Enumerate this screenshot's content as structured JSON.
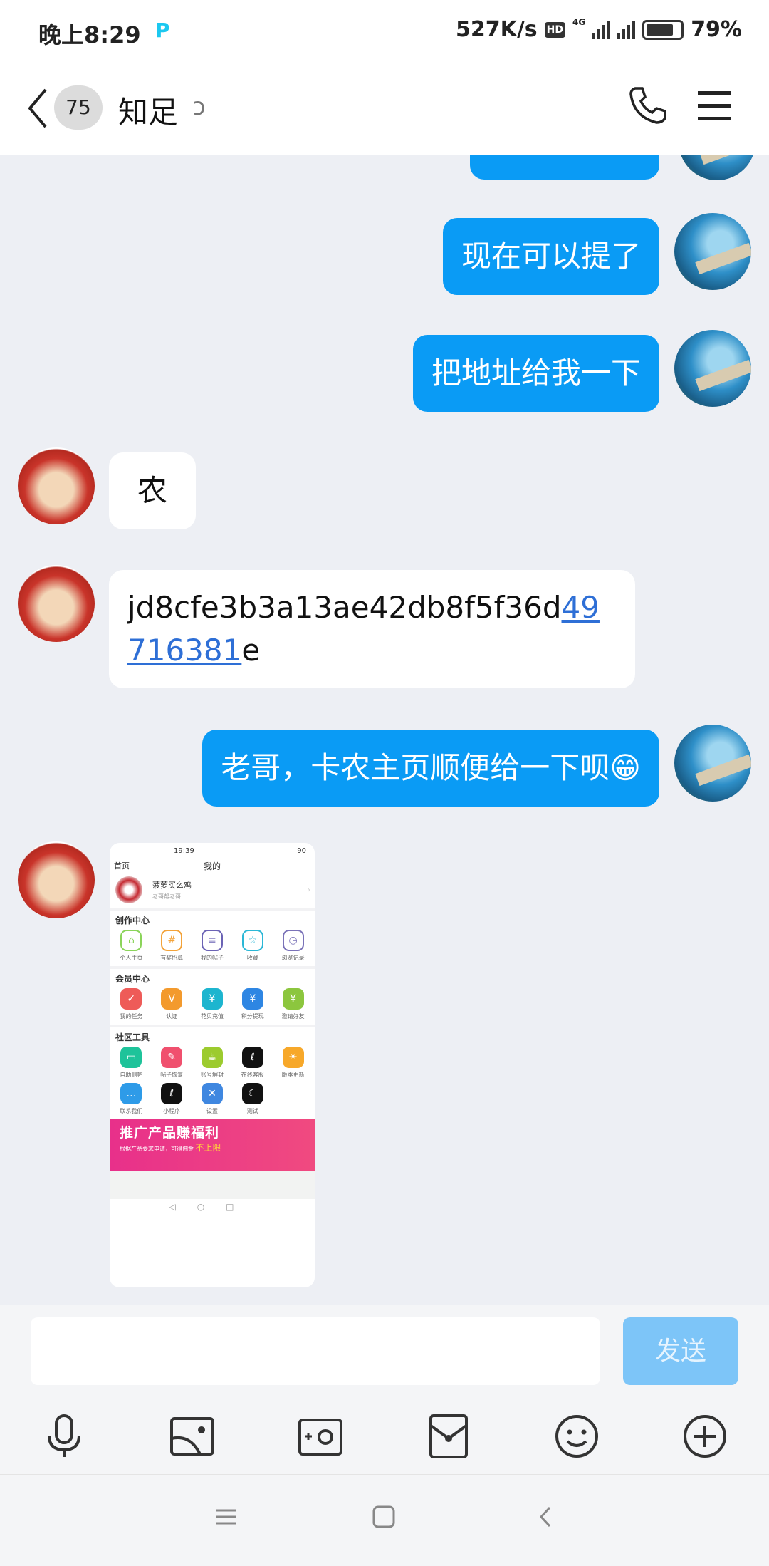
{
  "status_bar": {
    "time": "晚上8:29",
    "app_indicator": "P",
    "net_speed": "527K/s",
    "hd": "HD",
    "network": "4G",
    "battery": "79%",
    "battery_level": 79
  },
  "header": {
    "unread_count": "75",
    "title": "知足",
    "icons": [
      "back-chevron",
      "ear-icon",
      "phone-icon",
      "menu-icon"
    ]
  },
  "messages": [
    {
      "side": "me",
      "text": "现在可以提了"
    },
    {
      "side": "me",
      "text": "把地址给我一下"
    },
    {
      "side": "other",
      "text": "农"
    },
    {
      "side": "other",
      "text_prefix": "jd8cfe3b3a13ae42db8f5f36d",
      "link": "49716381",
      "text_suffix": "e"
    },
    {
      "side": "me",
      "text": "老哥，卡农主页顺便给一下呗😁"
    },
    {
      "side": "other",
      "type": "image"
    }
  ],
  "shared_image": {
    "time": "19:39",
    "battery": "90",
    "back": "首页",
    "title": "我的",
    "username": "菠萝买么鸡",
    "subtitle": "老哥帮老哥",
    "sections": [
      {
        "title": "创作中心",
        "items": [
          "个人主页",
          "有奖招募",
          "我的帖子",
          "收藏",
          "浏览记录"
        ]
      },
      {
        "title": "会员中心",
        "items": [
          "我的任务",
          "认证",
          "花贝充值",
          "积分提现",
          "邀请好友"
        ]
      },
      {
        "title": "社区工具",
        "items": [
          "自助删帖",
          "帖子恢复",
          "账号解封",
          "在线客服",
          "版本更新",
          "联系我们",
          "小程序",
          "设置",
          "测试"
        ]
      }
    ],
    "banner_title": "推广产品赚福利",
    "banner_sub": "根据产品要求申请，可得佣金",
    "banner_highlight": "不上限"
  },
  "input": {
    "placeholder": "",
    "send_label": "发送"
  },
  "toolbar": [
    "microphone-icon",
    "image-icon",
    "camera-icon",
    "red-packet-icon",
    "emoji-icon",
    "plus-icon"
  ],
  "colors": {
    "bubble_me": "#0A9BF5",
    "send_button": "#7DC5F8",
    "background": "#EDEFF4"
  }
}
